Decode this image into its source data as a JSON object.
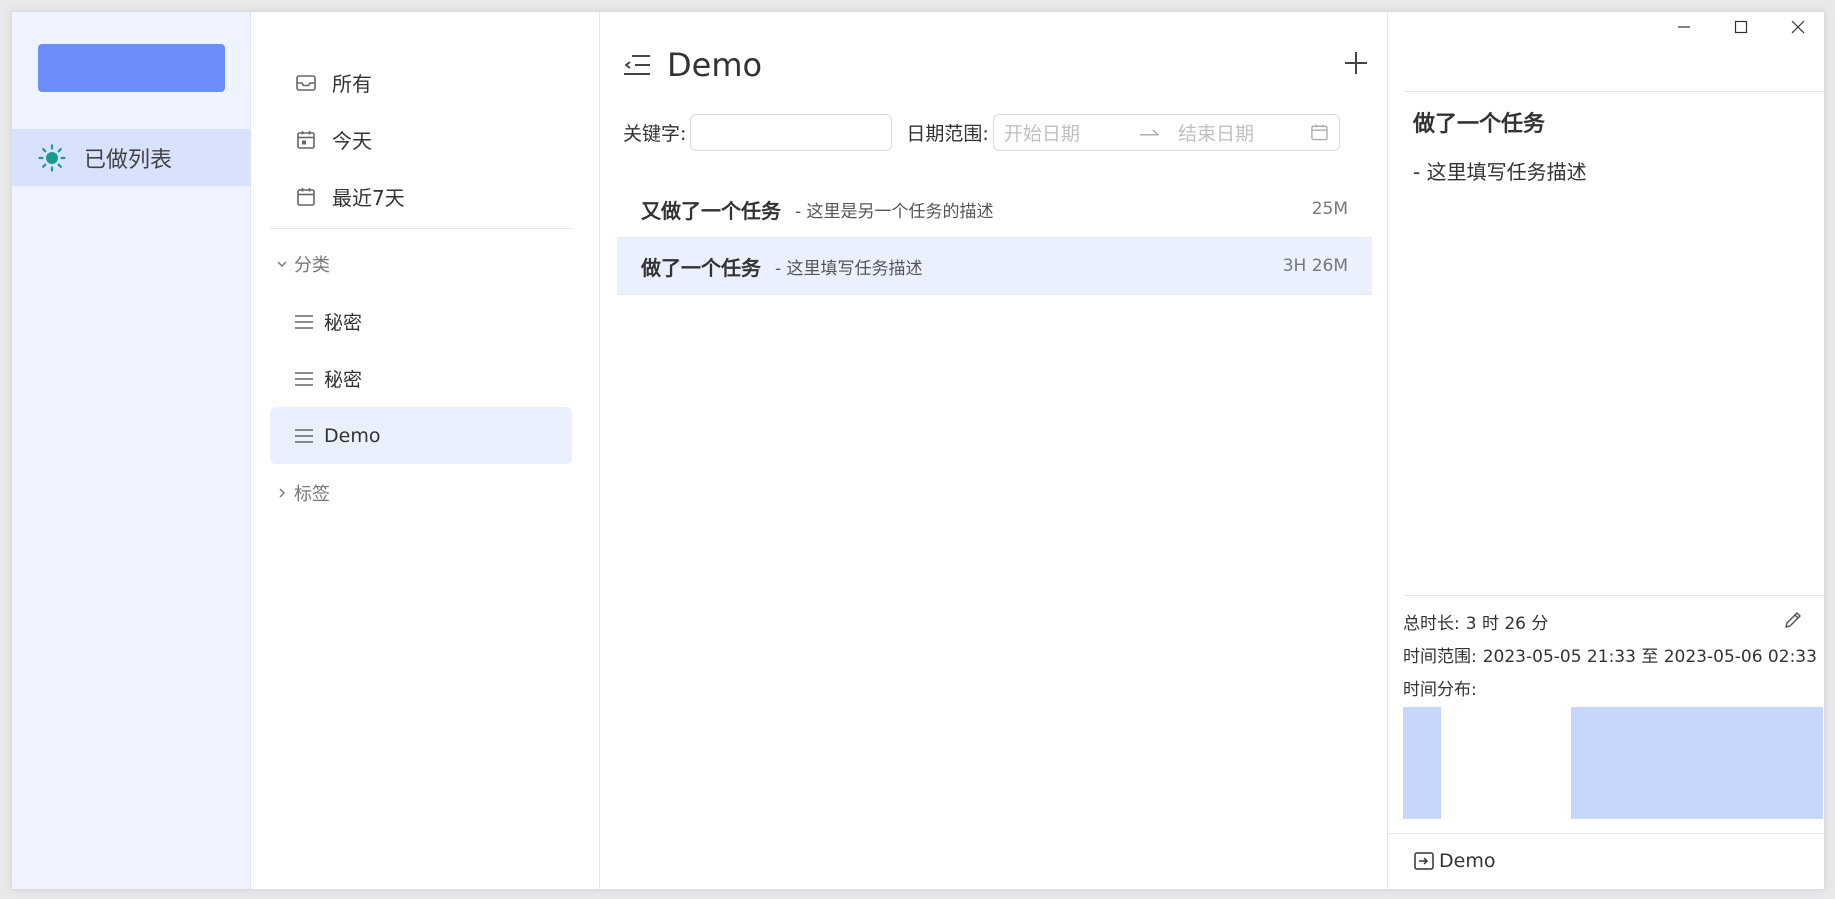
{
  "rail": {
    "items": [
      {
        "label": "已做列表",
        "icon": "sun-icon"
      }
    ]
  },
  "nav": {
    "fixed": [
      {
        "label": "所有",
        "icon": "inbox-icon"
      },
      {
        "label": "今天",
        "icon": "calendar-today-icon"
      },
      {
        "label": "最近7天",
        "icon": "calendar-week-icon"
      }
    ],
    "categories_header": "分类",
    "categories": [
      {
        "label": "秘密",
        "icon": "list-icon"
      },
      {
        "label": "秘密",
        "icon": "list-icon"
      },
      {
        "label": "Demo",
        "icon": "list-icon",
        "active": true
      }
    ],
    "tags_header": "标签"
  },
  "main": {
    "title": "Demo",
    "filters": {
      "keyword_label": "关键字:",
      "keyword_value": "",
      "date_label": "日期范围:",
      "start_placeholder": "开始日期",
      "end_placeholder": "结束日期"
    },
    "tasks": [
      {
        "title": "又做了一个任务",
        "desc": "- 这里是另一个任务的描述",
        "duration": "25M",
        "selected": false
      },
      {
        "title": "做了一个任务",
        "desc": "- 这里填写任务描述",
        "duration": "3H 26M",
        "selected": true
      }
    ]
  },
  "detail": {
    "title": "做了一个任务",
    "desc": "- 这里填写任务描述",
    "total_label": "总时长:",
    "total_value": "3 时 26 分",
    "range_label": "时间范围:",
    "range_value": "2023-05-05 21:33 至 2023-05-06 02:33",
    "dist_label": "时间分布:",
    "distribution": [
      {
        "start": 0.0,
        "end": 0.09
      },
      {
        "start": 0.4,
        "end": 1.0
      }
    ],
    "footer_category": "Demo"
  },
  "colors": {
    "accent": "#6c8ef8",
    "rail_bg": "#eff3ff",
    "rail_active": "#d8e2fc",
    "selection": "#eaf0fe",
    "distribution": "#c7d6fb",
    "sun": "#1a9c8c"
  }
}
